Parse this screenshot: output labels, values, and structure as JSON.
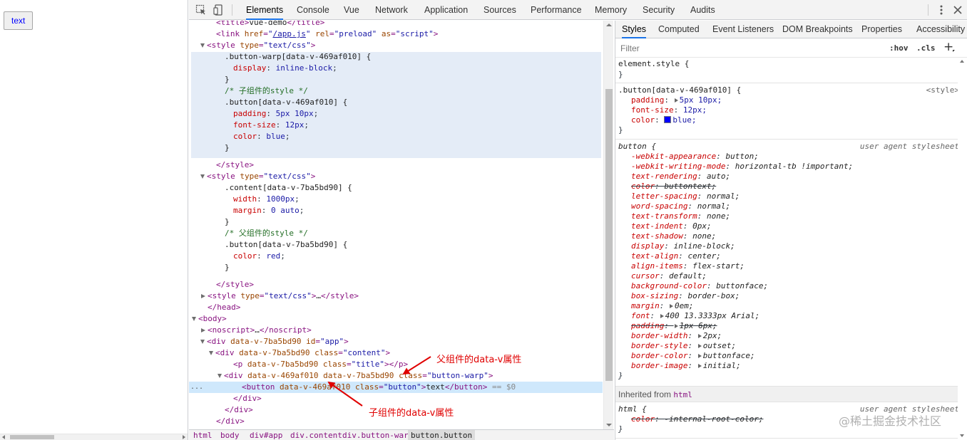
{
  "preview": {
    "button_text": "text"
  },
  "devtools": {
    "tabs": [
      "Elements",
      "Console",
      "Vue",
      "Network",
      "Application",
      "Sources",
      "Performance",
      "Memory",
      "Security",
      "Audits"
    ],
    "active_tab": "Elements"
  },
  "elements": {
    "lines": [
      {
        "kind": "tag",
        "text": "<title>vue-demo</title>"
      },
      {
        "kind": "tag",
        "text": "<link href=\"/app.js\" rel=\"preload\" as=\"script\">"
      },
      {
        "kind": "tag",
        "text": "<style type=\"text/css\">"
      },
      {
        "kind": "css",
        "text": ".button-warp[data-v-469af010] {"
      },
      {
        "kind": "css",
        "text": "display: inline-block;"
      },
      {
        "kind": "css",
        "text": "}"
      },
      {
        "kind": "comment",
        "text": "/* 子组件的style */"
      },
      {
        "kind": "css",
        "text": ".button[data-v-469af010] {"
      },
      {
        "kind": "css",
        "text": "padding: 5px 10px;"
      },
      {
        "kind": "css",
        "text": "font-size: 12px;"
      },
      {
        "kind": "css",
        "text": "color: blue;"
      },
      {
        "kind": "css",
        "text": "}"
      },
      {
        "kind": "tag",
        "text": "</style>"
      },
      {
        "kind": "tag",
        "text": "<style type=\"text/css\">"
      },
      {
        "kind": "css",
        "text": ".content[data-v-7ba5bd90] {"
      },
      {
        "kind": "css",
        "text": "width: 1000px;"
      },
      {
        "kind": "css",
        "text": "margin: 0 auto;"
      },
      {
        "kind": "css",
        "text": "}"
      },
      {
        "kind": "comment",
        "text": "/* 父组件的style */"
      },
      {
        "kind": "css",
        "text": ".button[data-v-7ba5bd90] {"
      },
      {
        "kind": "css",
        "text": "color: red;"
      },
      {
        "kind": "css",
        "text": "}"
      },
      {
        "kind": "tag",
        "text": "</style>"
      },
      {
        "kind": "tag",
        "text": "<style type=\"text/css\">…</style>"
      },
      {
        "kind": "tag",
        "text": "</head>"
      },
      {
        "kind": "tag",
        "text": "<body>"
      },
      {
        "kind": "tag",
        "text": "<noscript>…</noscript>"
      },
      {
        "kind": "tag",
        "text": "<div data-v-7ba5bd90 id=\"app\">"
      },
      {
        "kind": "tag",
        "text": "<div data-v-7ba5bd90 class=\"content\">"
      },
      {
        "kind": "tag",
        "text": "<p data-v-7ba5bd90 class=\"title\"></p>"
      },
      {
        "kind": "tag",
        "text": "<div data-v-469af010 data-v-7ba5bd90 class=\"button-warp\">"
      },
      {
        "kind": "tag",
        "text": "<button data-v-469af010 class=\"button\">text</button> == $0"
      },
      {
        "kind": "tag",
        "text": "</div>"
      },
      {
        "kind": "tag",
        "text": "</div>"
      },
      {
        "kind": "tag",
        "text": "</div>"
      }
    ],
    "ellipsis": "..."
  },
  "breadcrumb": [
    "html",
    "body",
    "div#app",
    "div.content",
    "div.button-warp",
    "button.button"
  ],
  "styles": {
    "tabs": [
      "Styles",
      "Computed",
      "Event Listeners",
      "DOM Breakpoints",
      "Properties",
      "Accessibility"
    ],
    "filter_placeholder": "Filter",
    "hov": ":hov",
    "cls": ".cls",
    "plus": "+",
    "element_style": {
      "selector": "element.style {",
      "close": "}"
    },
    "button_rule": {
      "selector": ".button[data-v-469af010] {",
      "source": "<style>",
      "props": [
        {
          "name": "padding",
          "value": "5px 10px;",
          "expand": true
        },
        {
          "name": "font-size",
          "value": "12px;"
        },
        {
          "name": "color",
          "value": "blue;",
          "swatch": "#0000ff"
        }
      ],
      "close": "}"
    },
    "ua_rule": {
      "selector": "button {",
      "source": "user agent stylesheet",
      "props": [
        {
          "name": "-webkit-appearance",
          "value": "button;"
        },
        {
          "name": "-webkit-writing-mode",
          "value": "horizontal-tb !important;"
        },
        {
          "name": "text-rendering",
          "value": "auto;"
        },
        {
          "name": "color",
          "value": "buttontext;",
          "struck": true
        },
        {
          "name": "letter-spacing",
          "value": "normal;"
        },
        {
          "name": "word-spacing",
          "value": "normal;"
        },
        {
          "name": "text-transform",
          "value": "none;"
        },
        {
          "name": "text-indent",
          "value": "0px;"
        },
        {
          "name": "text-shadow",
          "value": "none;"
        },
        {
          "name": "display",
          "value": "inline-block;"
        },
        {
          "name": "text-align",
          "value": "center;"
        },
        {
          "name": "align-items",
          "value": "flex-start;"
        },
        {
          "name": "cursor",
          "value": "default;"
        },
        {
          "name": "background-color",
          "value": "buttonface;"
        },
        {
          "name": "box-sizing",
          "value": "border-box;"
        },
        {
          "name": "margin",
          "value": "0em;",
          "expand": true
        },
        {
          "name": "font",
          "value": "400 13.3333px Arial;",
          "expand": true
        },
        {
          "name": "padding",
          "value": "1px 6px;",
          "struck": true,
          "expand": true
        },
        {
          "name": "border-width",
          "value": "2px;",
          "expand": true
        },
        {
          "name": "border-style",
          "value": "outset;",
          "expand": true
        },
        {
          "name": "border-color",
          "value": "buttonface;",
          "expand": true
        },
        {
          "name": "border-image",
          "value": "initial;",
          "expand": true
        }
      ],
      "close": "}"
    },
    "inherited": {
      "label": "Inherited from",
      "tag": "html"
    },
    "html_rule": {
      "selector": "html {",
      "source": "user agent stylesheet",
      "props": [
        {
          "name": "color",
          "value": "-internal-root-color;",
          "struck": true
        }
      ],
      "close": "}"
    }
  },
  "annotations": {
    "parent_label": "父组件的data-v属性",
    "child_label": "子组件的data-v属性",
    "color": "#e00000"
  },
  "watermark": "@稀土掘金技术社区"
}
